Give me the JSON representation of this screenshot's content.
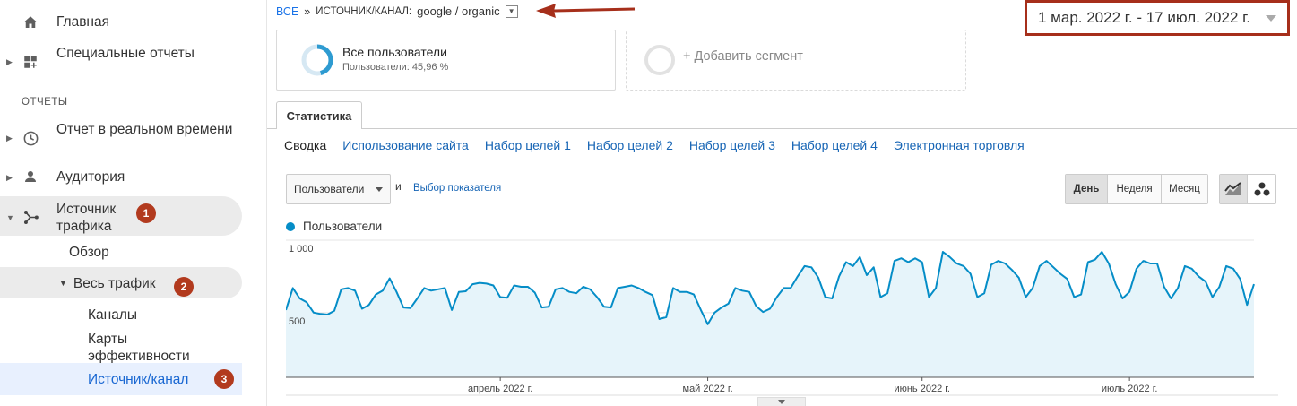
{
  "sidebar": {
    "home": "Главная",
    "custom_reports": "Специальные отчеты",
    "section_reports": "ОТЧЕТЫ",
    "realtime": "Отчет в реальном времени",
    "audience": "Аудитория",
    "acquisition": "Источник трафика",
    "overview": "Обзор",
    "all_traffic": "Весь трафик",
    "channels": "Каналы",
    "treemaps": "Карты эффективности",
    "source_medium": "Источник/канал",
    "badges": [
      "1",
      "2",
      "3"
    ]
  },
  "breadcrumb": {
    "all": "ВСЕ",
    "sep": "»",
    "dimension": "ИСТОЧНИК/КАНАЛ:",
    "value": "google / organic"
  },
  "date_range": "1 мар. 2022 г. - 17 июл. 2022 г.",
  "segments": {
    "primary_title": "Все пользователи",
    "primary_sub": "Пользователи: 45,96 %",
    "primary_share": 0.4596,
    "add": "+ Добавить сегмент"
  },
  "tab": "Статистика",
  "subtabs": [
    "Сводка",
    "Использование сайта",
    "Набор целей 1",
    "Набор целей 2",
    "Набор целей 3",
    "Набор целей 4",
    "Электронная торговля"
  ],
  "controls": {
    "metric": "Пользователи",
    "and": "и",
    "pick_metric": "Выбор показателя",
    "periods": [
      "День",
      "Неделя",
      "Месяц"
    ],
    "active_period": "День"
  },
  "colors": {
    "accent": "#058dc7",
    "annotation": "#a62f1b",
    "link": "#1765b5"
  },
  "chart_data": {
    "type": "area",
    "series": [
      {
        "name": "Пользователи"
      }
    ],
    "y_ticks": [
      "1 000",
      "500"
    ],
    "ylim": [
      0,
      1060
    ],
    "x_labels": [
      "апрель 2022 г.",
      "май 2022 г.",
      "июнь 2022 г.",
      "июль 2022 г."
    ],
    "x_label_days": [
      31,
      61,
      92,
      122
    ],
    "start_date": "2022-03-01",
    "values": [
      520,
      690,
      610,
      580,
      500,
      490,
      485,
      515,
      680,
      690,
      670,
      530,
      560,
      640,
      670,
      765,
      660,
      540,
      535,
      610,
      690,
      670,
      680,
      690,
      520,
      660,
      665,
      720,
      730,
      725,
      710,
      620,
      615,
      710,
      700,
      700,
      655,
      540,
      545,
      680,
      690,
      660,
      650,
      700,
      680,
      620,
      545,
      540,
      690,
      700,
      710,
      690,
      660,
      635,
      450,
      465,
      690,
      660,
      660,
      640,
      520,
      410,
      500,
      540,
      570,
      690,
      670,
      660,
      550,
      505,
      530,
      620,
      690,
      690,
      780,
      860,
      850,
      770,
      620,
      610,
      780,
      890,
      860,
      930,
      790,
      850,
      620,
      650,
      900,
      920,
      890,
      920,
      890,
      620,
      690,
      970,
      930,
      880,
      860,
      800,
      620,
      650,
      870,
      900,
      880,
      830,
      770,
      620,
      690,
      860,
      900,
      850,
      800,
      760,
      620,
      640,
      890,
      910,
      970,
      880,
      720,
      610,
      660,
      840,
      900,
      880,
      880,
      700,
      610,
      690,
      860,
      840,
      780,
      740,
      620,
      700,
      860,
      840,
      760,
      560,
      720
    ],
    "grid": true
  }
}
